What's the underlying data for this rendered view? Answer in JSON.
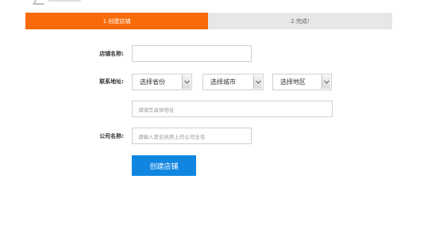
{
  "steps": [
    {
      "label": "1.创建店铺",
      "state": "active"
    },
    {
      "label": "2.完成!",
      "state": "todo"
    }
  ],
  "form": {
    "shop_name": {
      "label": "店铺名称:",
      "value": "",
      "placeholder": ""
    },
    "contact_address": {
      "label": "联系地址:",
      "province": "选择省份",
      "city": "选择城市",
      "district": "选择地区",
      "detail_placeholder": "请填写具体地址"
    },
    "company_name": {
      "label": "公司名称:",
      "placeholder": "请输入营业执照上的公司全名"
    },
    "submit_label": "创建店铺"
  },
  "colors": {
    "step_active": "#f96a09",
    "step_todo": "#e7e7e7",
    "primary_button": "#1086e0"
  },
  "icons": {
    "select_arrow": "chevron-down-icon"
  }
}
